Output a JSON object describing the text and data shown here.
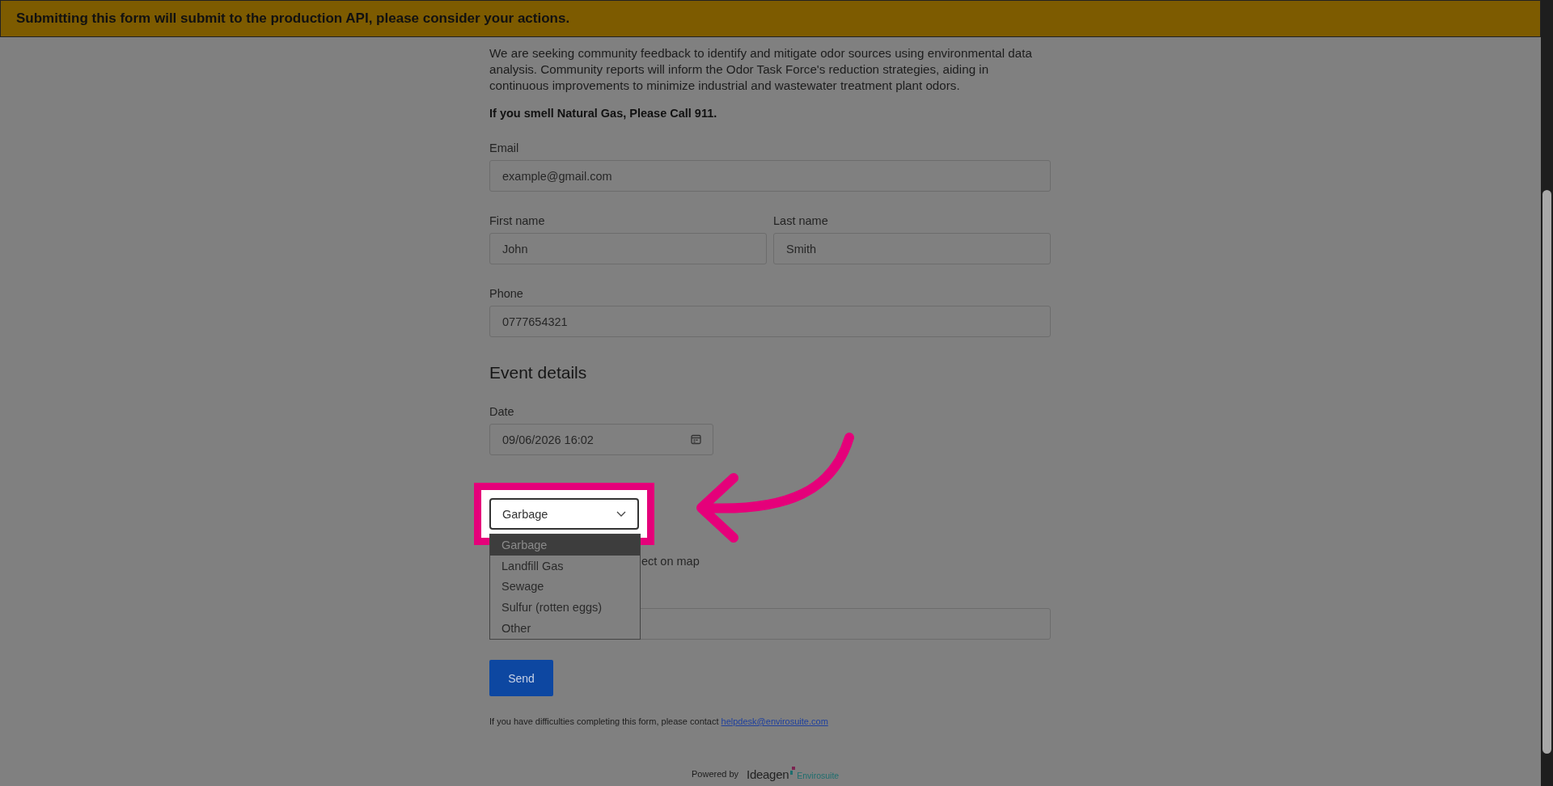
{
  "banner": {
    "text": "Submitting this form will submit to the production API, please consider your actions."
  },
  "intro": {
    "paragraph": "We are seeking community feedback to identify and mitigate odor sources using environmental data analysis. Community reports will inform the Odor Task Force's reduction strategies, aiding in continuous improvements to minimize industrial and wastewater treatment plant odors.",
    "warning": "If you smell Natural Gas, Please Call 911."
  },
  "contact_rows": [
    {
      "fields": [
        {
          "label": "Email",
          "value": "example@gmail.com"
        }
      ]
    },
    {
      "fields": [
        {
          "label": "First name",
          "value": "John"
        },
        {
          "label": "Last name",
          "value": "Smith"
        }
      ]
    },
    {
      "fields": [
        {
          "label": "Phone",
          "value": "0777654321"
        }
      ]
    }
  ],
  "section_title": "Event details",
  "date": {
    "label": "Date",
    "value": "09/06/2026 16:02"
  },
  "type_select": {
    "value": "Garbage",
    "expanded": true,
    "highlighted": true,
    "options": [
      {
        "label": "Garbage",
        "selected": true
      },
      {
        "label": "Landfill Gas",
        "selected": false
      },
      {
        "label": "Sewage",
        "selected": false
      },
      {
        "label": "Sulfur (rotten eggs)",
        "selected": false
      },
      {
        "label": "Other",
        "selected": false
      }
    ]
  },
  "map_option": {
    "text": "ect on map"
  },
  "send_button": "Send",
  "footer": {
    "text": "If you have difficulties completing this form, please contact",
    "link": "helpdesk@envirosuite.com"
  },
  "powered_by": {
    "label": "Powered by",
    "brand": "Ideagen",
    "product": "Envirosuite"
  }
}
